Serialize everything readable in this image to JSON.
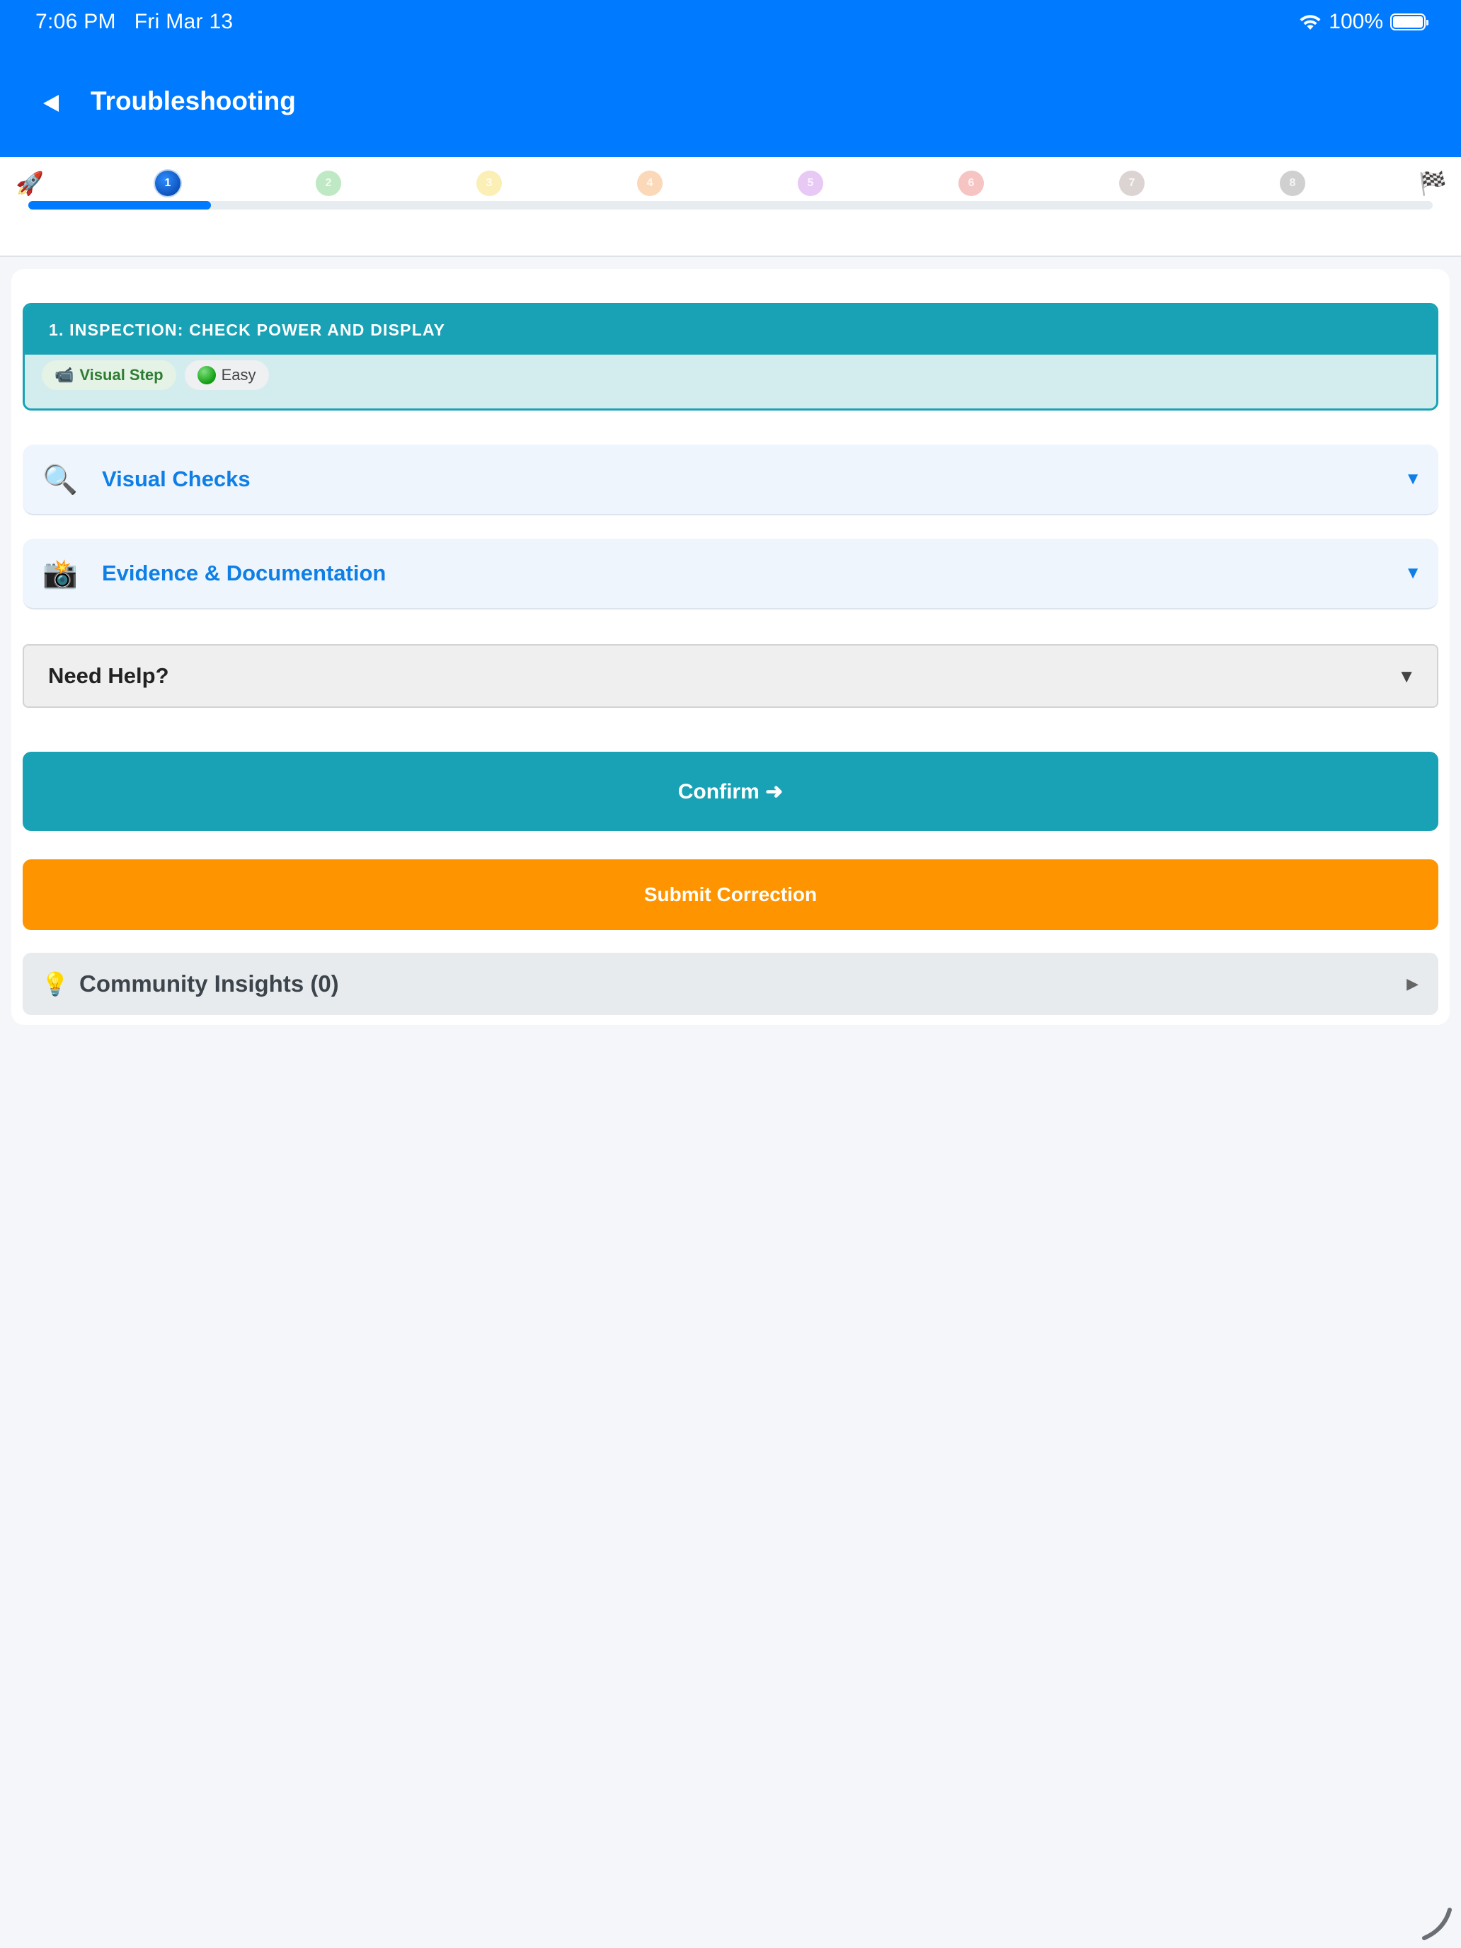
{
  "status_bar": {
    "time": "7:06 PM",
    "date": "Fri Mar 13",
    "battery": "100%"
  },
  "nav": {
    "title": "Troubleshooting"
  },
  "progress": {
    "start_icon": "🚀",
    "end_icon": "🏁",
    "current_step": 1,
    "total_steps": 8,
    "fraction": 0.13,
    "steps": [
      {
        "label": "1",
        "color": "#0a4fb8",
        "active": true
      },
      {
        "label": "2",
        "color": "#bfe8c4",
        "active": false
      },
      {
        "label": "3",
        "color": "#fbefb6",
        "active": false
      },
      {
        "label": "4",
        "color": "#fbd9b8",
        "active": false
      },
      {
        "label": "5",
        "color": "#e8c8f4",
        "active": false
      },
      {
        "label": "6",
        "color": "#f7c4c4",
        "active": false
      },
      {
        "label": "7",
        "color": "#dcd4d2",
        "active": false
      },
      {
        "label": "8",
        "color": "#d0d0d0",
        "active": false
      }
    ],
    "accent": "#007aff"
  },
  "step": {
    "title": "1. INSPECTION: CHECK POWER AND DISPLAY",
    "badge_visual": "Visual Step",
    "badge_visual_icon": "📹",
    "badge_difficulty": "Easy"
  },
  "sections": {
    "visual_checks": {
      "icon": "🔍",
      "label": "Visual Checks",
      "chevron": "▼"
    },
    "evidence": {
      "icon": "📸",
      "label": "Evidence & Documentation",
      "chevron": "▼"
    }
  },
  "help": {
    "label": "Need Help?",
    "chevron": "▼"
  },
  "buttons": {
    "confirm": "Confirm ➜",
    "submit": "Submit Correction"
  },
  "community": {
    "icon": "💡",
    "label": "Community Insights (0)",
    "chevron": "▶"
  },
  "colors": {
    "header": "#007aff",
    "teal": "#19a2b5",
    "orange": "#fe9500"
  }
}
